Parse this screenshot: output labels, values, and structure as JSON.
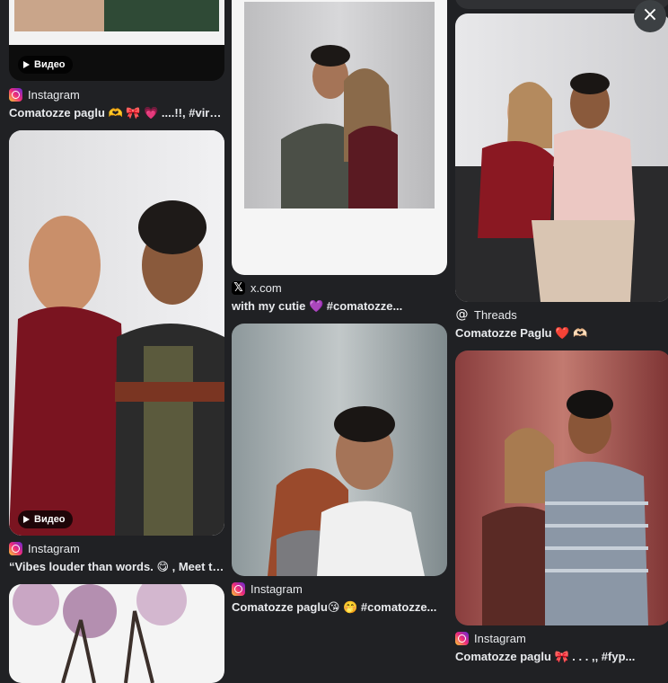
{
  "close_icon": "×",
  "cards": [
    {
      "source": "Instagram",
      "title": "Comatozze paglu 🫶 🎀 💗 ....!!, #viral ,...",
      "badge": "Видео"
    },
    {
      "source": "Instagram",
      "title": "“Vibes louder than words. 😋 , Meet to...",
      "badge": "Видео"
    },
    {
      "source": "x.com",
      "title": "with my cutie 💜 #comatozze..."
    },
    {
      "source": "Instagram",
      "title": "Comatozze paglu😘 🤭 #comatozze..."
    },
    {
      "source": "Threads",
      "title": "Comatozze Paglu ❤️ 🫶🏻"
    },
    {
      "source": "Instagram",
      "title": "Comatozze paglu 🎀 . . . ,, #fyp..."
    }
  ]
}
